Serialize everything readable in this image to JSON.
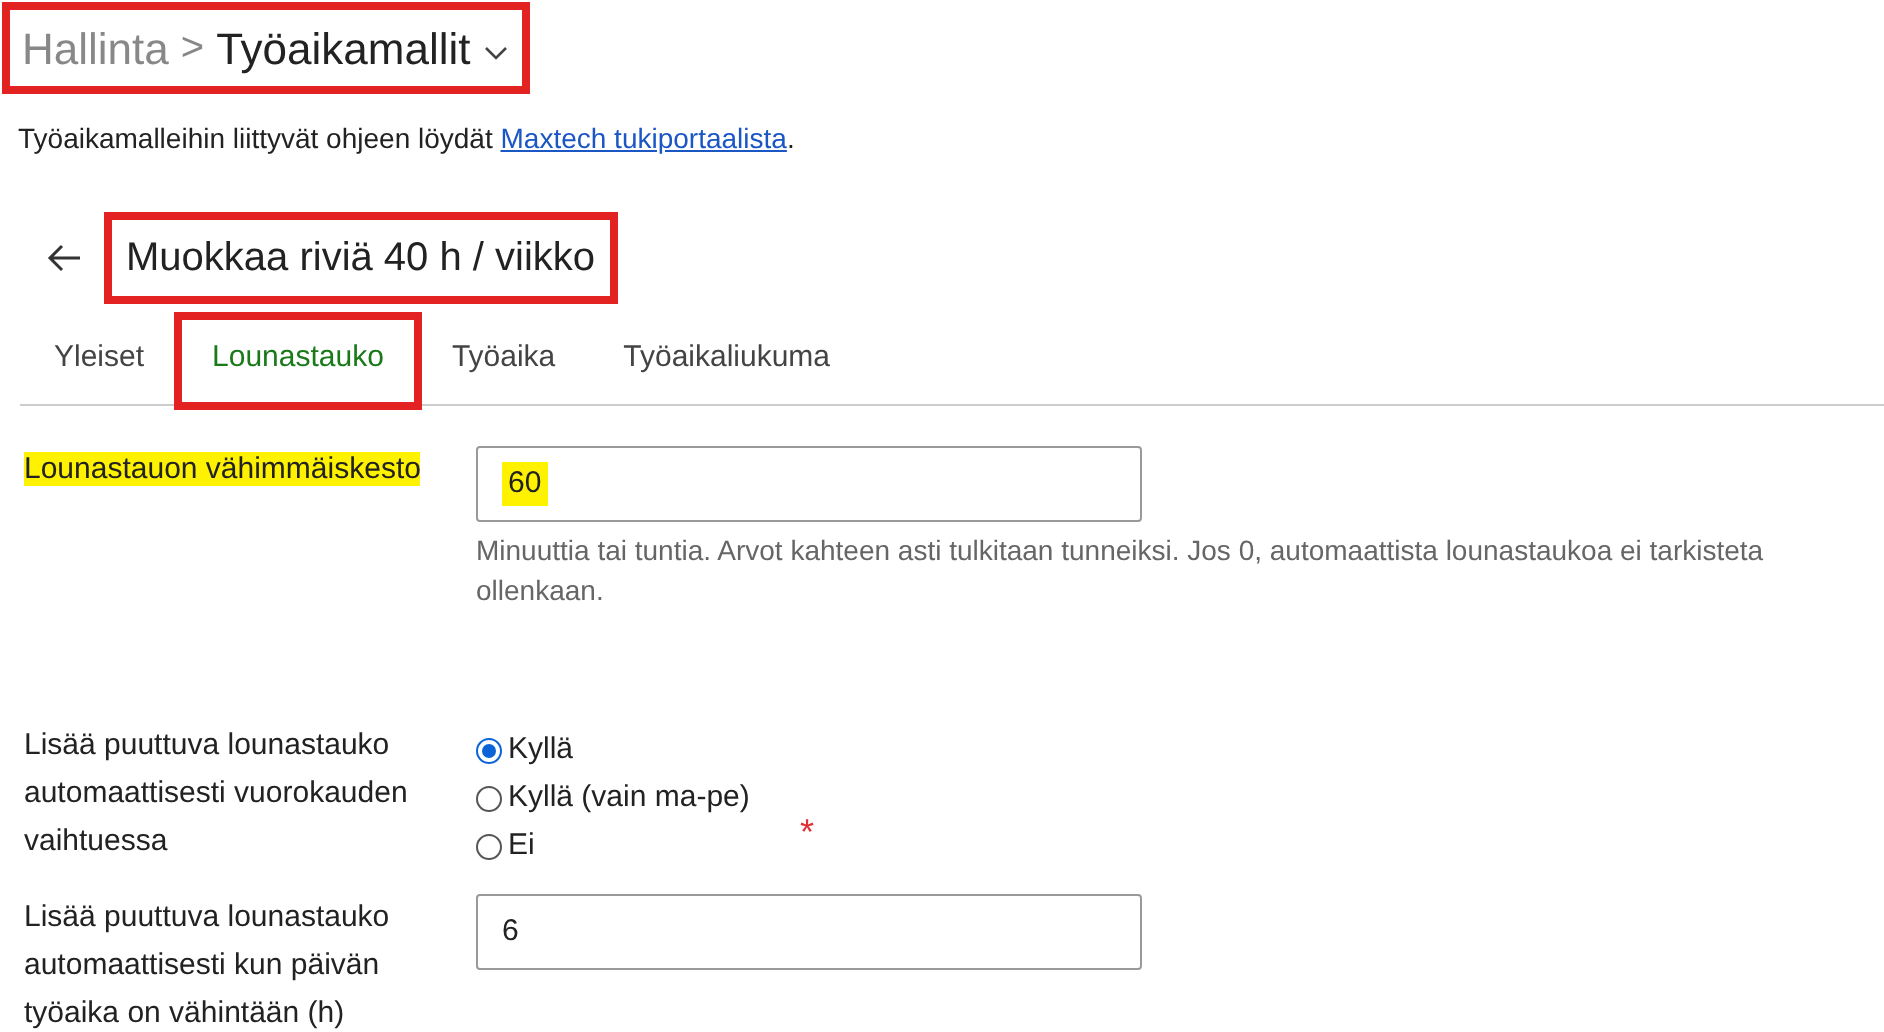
{
  "breadcrumb": {
    "parent": "Hallinta",
    "separator": ">",
    "current": "Työaikamallit",
    "annotated": true
  },
  "help": {
    "text": "Työaikamalleihin liittyvät ohjeen löydät ",
    "link": "Maxtech tukiportaalista",
    "end": "."
  },
  "heading": {
    "title": "Muokkaa riviä 40 h / viikko",
    "annotated": true
  },
  "tabs": [
    {
      "label": "Yleiset",
      "selected": false,
      "annotated": false
    },
    {
      "label": "Lounastauko",
      "selected": true,
      "annotated": true
    },
    {
      "label": "Työaika",
      "selected": false,
      "annotated": false
    },
    {
      "label": "Työaikaliukuma",
      "selected": false,
      "annotated": false
    }
  ],
  "fields": [
    {
      "kind": "text",
      "label": "Lounastauon vähimmäiskesto",
      "highlighted": true,
      "value": "60",
      "value_highlighted": true,
      "hint": "Minuuttia tai tuntia. Arvot kahteen asti tulkitaan tunneiksi. Jos 0, automaattista lounastaukoa ei tarkisteta ollenkaan."
    },
    {
      "kind": "radio",
      "label": "Lisää puuttuva lounastauko automaattisesti vuorokauden vaihtuessa",
      "highlighted": false,
      "required_mark": "*",
      "options": [
        {
          "label": "Kyllä",
          "selected": true
        },
        {
          "label": "Kyllä (vain ma-pe)",
          "selected": false
        },
        {
          "label": "Ei",
          "selected": false
        }
      ]
    },
    {
      "kind": "text",
      "label": "Lisää puuttuva lounastauko automaattisesti kun päivän työaika on vähintään (h)",
      "highlighted": false,
      "value": "6",
      "value_highlighted": false
    }
  ]
}
